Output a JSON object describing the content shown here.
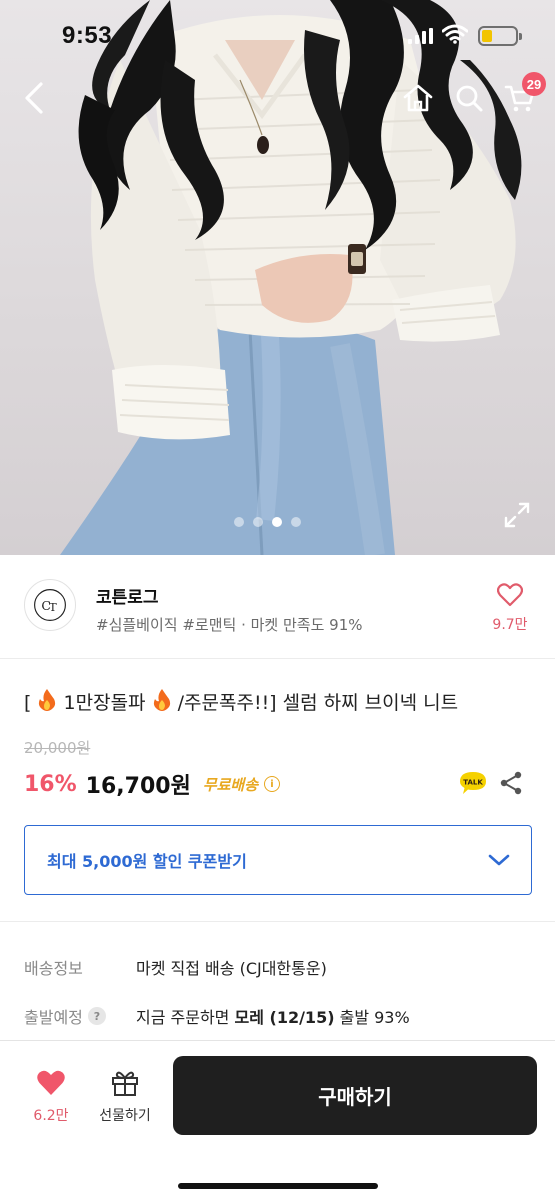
{
  "status_bar": {
    "time": "9:53",
    "battery_level": 0.3
  },
  "hero": {
    "icons": {
      "back": "chevron-left-icon",
      "home": "home-icon",
      "search": "search-icon",
      "cart": "cart-icon",
      "expand": "expand-icon"
    },
    "cart_badge": "29",
    "gallery": {
      "total": 4,
      "current_index": 2
    }
  },
  "seller": {
    "name": "코튼로그",
    "tags": "#심플베이직 #로맨틱 · 마켓 만족도 91%",
    "wishlist_count": "9.7만"
  },
  "product": {
    "title_parts": [
      "[",
      "1만장돌파",
      "/주문폭주!!] 셀럼 하찌 브이넥 니트"
    ],
    "original_price": "20,000원",
    "discount": "16%",
    "price": "16,700원",
    "shipping_badge": "무료배송",
    "talk_label": "TALK"
  },
  "coupon": {
    "label": "최대 5,000원 할인 쿠폰받기"
  },
  "info": {
    "delivery_label": "배송정보",
    "delivery_value": "마켓 직접 배송 (CJ대한통운)",
    "dispatch_label": "출발예정",
    "dispatch_prefix": "지금 주문하면 ",
    "dispatch_date": "모레 (12/15)",
    "dispatch_suffix": " 출발 93%"
  },
  "bottom_bar": {
    "like_count": "6.2만",
    "gift_label": "선물하기",
    "buy_label": "구매하기"
  },
  "colors": {
    "accent": "#f0566a",
    "link_blue": "#2e6ad3",
    "free_ship": "#e8a820",
    "buy_bg": "#1f1f1f"
  }
}
